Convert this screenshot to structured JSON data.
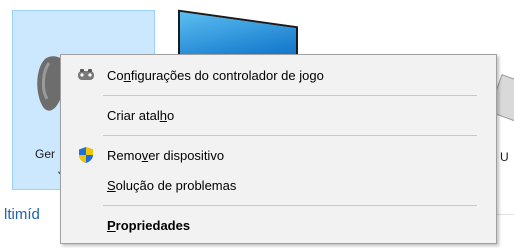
{
  "background": {
    "tile_label_line1": "Ger",
    "tile_label_line2": "J",
    "right_label": "U",
    "section_title": "ltimíd"
  },
  "menu": {
    "items": [
      {
        "pre": "Co",
        "u": "n",
        "post": "figurações do controlador de jogo",
        "icon": "gamepad-icon"
      },
      {
        "pre": "Criar atal",
        "u": "h",
        "post": "o"
      },
      {
        "pre": "Remo",
        "u": "v",
        "post": "er dispositivo",
        "icon": "shield-icon"
      },
      {
        "pre": "",
        "u": "S",
        "post": "olução de problemas"
      },
      {
        "pre": "",
        "u": "P",
        "post": "ropriedades"
      }
    ]
  },
  "colors": {
    "selection": "#cce8ff",
    "menu_bg": "#f2f2f2",
    "link": "#1e62b0"
  }
}
